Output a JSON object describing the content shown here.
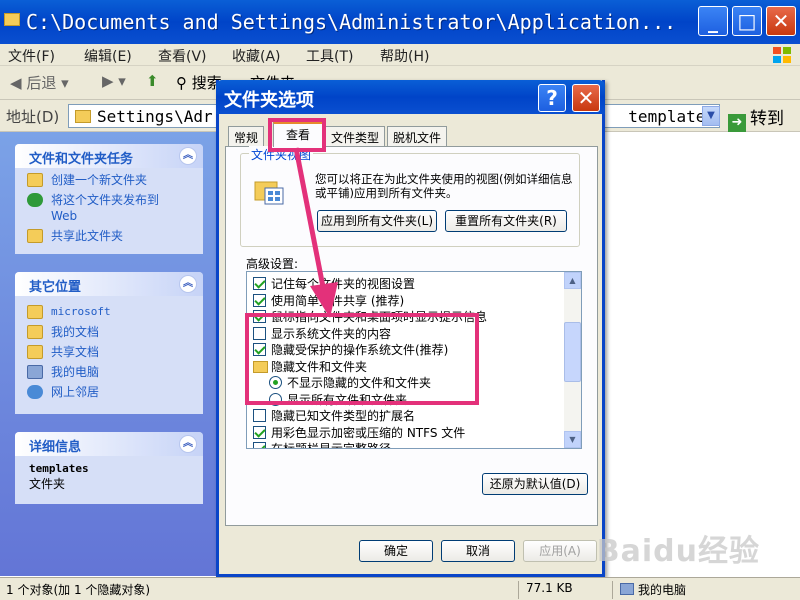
{
  "window": {
    "title": "C:\\Documents and Settings\\Administrator\\Application..."
  },
  "menu": [
    "文件(F)",
    "编辑(E)",
    "查看(V)",
    "收藏(A)",
    "工具(T)",
    "帮助(H)"
  ],
  "toolbar": {
    "back": "后退",
    "search": "搜索",
    "folders": "文件夹"
  },
  "address": {
    "label": "地址(D)",
    "value": "Settings\\Adr",
    "value_right": "templates",
    "go": "转到"
  },
  "left_panels": {
    "tasks": {
      "title": "文件和文件夹任务",
      "items": [
        "创建一个新文件夹",
        "将这个文件夹发布到 Web",
        "共享此文件夹"
      ]
    },
    "places": {
      "title": "其它位置",
      "items": [
        "microsoft",
        "我的文档",
        "共享文档",
        "我的电脑",
        "网上邻居"
      ]
    },
    "details": {
      "title": "详细信息",
      "name": "templates",
      "type": "文件夹"
    }
  },
  "dialog": {
    "title": "文件夹选项",
    "tabs": [
      "常规",
      "查看",
      "文件类型",
      "脱机文件"
    ],
    "active_tab": "查看",
    "group_label": "文件夹视图",
    "group_desc": "您可以将正在为此文件夹使用的视图(例如详细信息或平铺)应用到所有文件夹。",
    "apply_all": "应用到所有文件夹(L)",
    "reset_all": "重置所有文件夹(R)",
    "advanced_label": "高级设置:",
    "settings": [
      {
        "type": "checkbox",
        "checked": true,
        "indent": 0,
        "label": "记住每个文件夹的视图设置"
      },
      {
        "type": "checkbox",
        "checked": true,
        "indent": 0,
        "label": "使用简单文件共享 (推荐)"
      },
      {
        "type": "checkbox",
        "checked": true,
        "indent": 0,
        "label": "鼠标指向文件夹和桌面项时显示提示信息"
      },
      {
        "type": "checkbox",
        "checked": false,
        "indent": 0,
        "label": "显示系统文件夹的内容"
      },
      {
        "type": "checkbox",
        "checked": true,
        "indent": 0,
        "label": "隐藏受保护的操作系统文件(推荐)"
      },
      {
        "type": "folder",
        "indent": 0,
        "label": "隐藏文件和文件夹"
      },
      {
        "type": "radio",
        "checked": true,
        "indent": 1,
        "label": "不显示隐藏的文件和文件夹"
      },
      {
        "type": "radio",
        "checked": false,
        "indent": 1,
        "label": "显示所有文件和文件夹"
      },
      {
        "type": "checkbox",
        "checked": false,
        "indent": 0,
        "label": "隐藏已知文件类型的扩展名"
      },
      {
        "type": "checkbox",
        "checked": true,
        "indent": 0,
        "label": "用彩色显示加密或压缩的 NTFS 文件"
      },
      {
        "type": "checkbox",
        "checked": true,
        "indent": 0,
        "label": "在标题栏显示完整路径"
      }
    ],
    "restore_defaults": "还原为默认值(D)",
    "ok": "确定",
    "cancel": "取消",
    "apply": "应用(A)"
  },
  "status": {
    "objects": "1 个对象(加 1 个隐藏对象)",
    "size": "77.1 KB",
    "location": "我的电脑"
  },
  "watermark": "Baidu经验",
  "colors": {
    "highlight": "#e3317a",
    "xp_blue": "#0a5fd6",
    "link": "#215dc6"
  }
}
